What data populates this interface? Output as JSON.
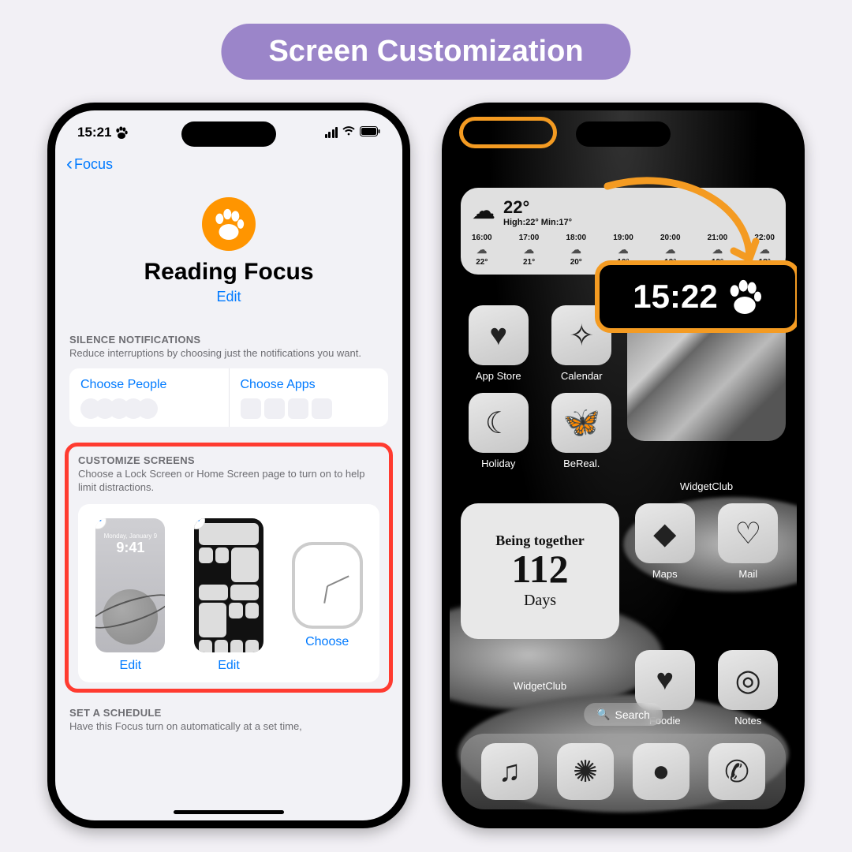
{
  "page_title": "Screen Customization",
  "left": {
    "status_time": "15:21",
    "back_label": "Focus",
    "focus_title": "Reading Focus",
    "edit": "Edit",
    "silence": {
      "title": "SILENCE NOTIFICATIONS",
      "desc": "Reduce interruptions by choosing just the notifications you want.",
      "choose_people": "Choose People",
      "choose_apps": "Choose Apps"
    },
    "customize": {
      "title": "CUSTOMIZE SCREENS",
      "desc": "Choose a Lock Screen or Home Screen page to turn on to help limit distractions.",
      "lock_time": "9:41",
      "lock_date": "Monday, January 9",
      "edit1": "Edit",
      "edit2": "Edit",
      "choose": "Choose"
    },
    "schedule": {
      "title": "SET A SCHEDULE",
      "desc": "Have this Focus turn on automatically at a set time,"
    }
  },
  "right": {
    "status_time": "15:22",
    "zoom_time": "15:22",
    "weather": {
      "temp": "22°",
      "range": "High:22° Min:17°",
      "hours": [
        {
          "t": "16:00",
          "v": "22°"
        },
        {
          "t": "17:00",
          "v": "21°"
        },
        {
          "t": "18:00",
          "v": "20°"
        },
        {
          "t": "19:00",
          "v": "19°"
        },
        {
          "t": "20:00",
          "v": "19°"
        },
        {
          "t": "21:00",
          "v": "19°"
        },
        {
          "t": "22:00",
          "v": "18°"
        }
      ],
      "label": "WidgetClub"
    },
    "apps": {
      "appstore": "App Store",
      "calendar": "Calendar",
      "holiday": "Holiday",
      "bereal": "BeReal.",
      "widgetclub": "WidgetClub",
      "maps": "Maps",
      "mail": "Mail",
      "foodie": "Foodie",
      "notes": "Notes"
    },
    "days_widget": {
      "title": "Being together",
      "count": "112",
      "unit": "Days",
      "label": "WidgetClub"
    },
    "search": "Search"
  }
}
